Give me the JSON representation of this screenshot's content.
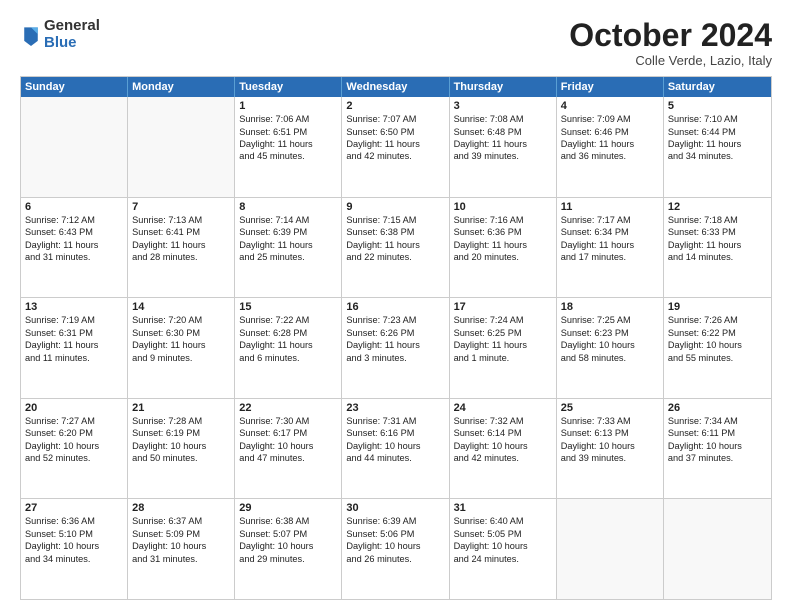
{
  "header": {
    "logo_general": "General",
    "logo_blue": "Blue",
    "month_title": "October 2024",
    "subtitle": "Colle Verde, Lazio, Italy"
  },
  "days_of_week": [
    "Sunday",
    "Monday",
    "Tuesday",
    "Wednesday",
    "Thursday",
    "Friday",
    "Saturday"
  ],
  "weeks": [
    [
      {
        "day": "",
        "empty": true
      },
      {
        "day": "",
        "empty": true
      },
      {
        "day": "1",
        "line1": "Sunrise: 7:06 AM",
        "line2": "Sunset: 6:51 PM",
        "line3": "Daylight: 11 hours",
        "line4": "and 45 minutes."
      },
      {
        "day": "2",
        "line1": "Sunrise: 7:07 AM",
        "line2": "Sunset: 6:50 PM",
        "line3": "Daylight: 11 hours",
        "line4": "and 42 minutes."
      },
      {
        "day": "3",
        "line1": "Sunrise: 7:08 AM",
        "line2": "Sunset: 6:48 PM",
        "line3": "Daylight: 11 hours",
        "line4": "and 39 minutes."
      },
      {
        "day": "4",
        "line1": "Sunrise: 7:09 AM",
        "line2": "Sunset: 6:46 PM",
        "line3": "Daylight: 11 hours",
        "line4": "and 36 minutes."
      },
      {
        "day": "5",
        "line1": "Sunrise: 7:10 AM",
        "line2": "Sunset: 6:44 PM",
        "line3": "Daylight: 11 hours",
        "line4": "and 34 minutes."
      }
    ],
    [
      {
        "day": "6",
        "line1": "Sunrise: 7:12 AM",
        "line2": "Sunset: 6:43 PM",
        "line3": "Daylight: 11 hours",
        "line4": "and 31 minutes."
      },
      {
        "day": "7",
        "line1": "Sunrise: 7:13 AM",
        "line2": "Sunset: 6:41 PM",
        "line3": "Daylight: 11 hours",
        "line4": "and 28 minutes."
      },
      {
        "day": "8",
        "line1": "Sunrise: 7:14 AM",
        "line2": "Sunset: 6:39 PM",
        "line3": "Daylight: 11 hours",
        "line4": "and 25 minutes."
      },
      {
        "day": "9",
        "line1": "Sunrise: 7:15 AM",
        "line2": "Sunset: 6:38 PM",
        "line3": "Daylight: 11 hours",
        "line4": "and 22 minutes."
      },
      {
        "day": "10",
        "line1": "Sunrise: 7:16 AM",
        "line2": "Sunset: 6:36 PM",
        "line3": "Daylight: 11 hours",
        "line4": "and 20 minutes."
      },
      {
        "day": "11",
        "line1": "Sunrise: 7:17 AM",
        "line2": "Sunset: 6:34 PM",
        "line3": "Daylight: 11 hours",
        "line4": "and 17 minutes."
      },
      {
        "day": "12",
        "line1": "Sunrise: 7:18 AM",
        "line2": "Sunset: 6:33 PM",
        "line3": "Daylight: 11 hours",
        "line4": "and 14 minutes."
      }
    ],
    [
      {
        "day": "13",
        "line1": "Sunrise: 7:19 AM",
        "line2": "Sunset: 6:31 PM",
        "line3": "Daylight: 11 hours",
        "line4": "and 11 minutes."
      },
      {
        "day": "14",
        "line1": "Sunrise: 7:20 AM",
        "line2": "Sunset: 6:30 PM",
        "line3": "Daylight: 11 hours",
        "line4": "and 9 minutes."
      },
      {
        "day": "15",
        "line1": "Sunrise: 7:22 AM",
        "line2": "Sunset: 6:28 PM",
        "line3": "Daylight: 11 hours",
        "line4": "and 6 minutes."
      },
      {
        "day": "16",
        "line1": "Sunrise: 7:23 AM",
        "line2": "Sunset: 6:26 PM",
        "line3": "Daylight: 11 hours",
        "line4": "and 3 minutes."
      },
      {
        "day": "17",
        "line1": "Sunrise: 7:24 AM",
        "line2": "Sunset: 6:25 PM",
        "line3": "Daylight: 11 hours",
        "line4": "and 1 minute."
      },
      {
        "day": "18",
        "line1": "Sunrise: 7:25 AM",
        "line2": "Sunset: 6:23 PM",
        "line3": "Daylight: 10 hours",
        "line4": "and 58 minutes."
      },
      {
        "day": "19",
        "line1": "Sunrise: 7:26 AM",
        "line2": "Sunset: 6:22 PM",
        "line3": "Daylight: 10 hours",
        "line4": "and 55 minutes."
      }
    ],
    [
      {
        "day": "20",
        "line1": "Sunrise: 7:27 AM",
        "line2": "Sunset: 6:20 PM",
        "line3": "Daylight: 10 hours",
        "line4": "and 52 minutes."
      },
      {
        "day": "21",
        "line1": "Sunrise: 7:28 AM",
        "line2": "Sunset: 6:19 PM",
        "line3": "Daylight: 10 hours",
        "line4": "and 50 minutes."
      },
      {
        "day": "22",
        "line1": "Sunrise: 7:30 AM",
        "line2": "Sunset: 6:17 PM",
        "line3": "Daylight: 10 hours",
        "line4": "and 47 minutes."
      },
      {
        "day": "23",
        "line1": "Sunrise: 7:31 AM",
        "line2": "Sunset: 6:16 PM",
        "line3": "Daylight: 10 hours",
        "line4": "and 44 minutes."
      },
      {
        "day": "24",
        "line1": "Sunrise: 7:32 AM",
        "line2": "Sunset: 6:14 PM",
        "line3": "Daylight: 10 hours",
        "line4": "and 42 minutes."
      },
      {
        "day": "25",
        "line1": "Sunrise: 7:33 AM",
        "line2": "Sunset: 6:13 PM",
        "line3": "Daylight: 10 hours",
        "line4": "and 39 minutes."
      },
      {
        "day": "26",
        "line1": "Sunrise: 7:34 AM",
        "line2": "Sunset: 6:11 PM",
        "line3": "Daylight: 10 hours",
        "line4": "and 37 minutes."
      }
    ],
    [
      {
        "day": "27",
        "line1": "Sunrise: 6:36 AM",
        "line2": "Sunset: 5:10 PM",
        "line3": "Daylight: 10 hours",
        "line4": "and 34 minutes."
      },
      {
        "day": "28",
        "line1": "Sunrise: 6:37 AM",
        "line2": "Sunset: 5:09 PM",
        "line3": "Daylight: 10 hours",
        "line4": "and 31 minutes."
      },
      {
        "day": "29",
        "line1": "Sunrise: 6:38 AM",
        "line2": "Sunset: 5:07 PM",
        "line3": "Daylight: 10 hours",
        "line4": "and 29 minutes."
      },
      {
        "day": "30",
        "line1": "Sunrise: 6:39 AM",
        "line2": "Sunset: 5:06 PM",
        "line3": "Daylight: 10 hours",
        "line4": "and 26 minutes."
      },
      {
        "day": "31",
        "line1": "Sunrise: 6:40 AM",
        "line2": "Sunset: 5:05 PM",
        "line3": "Daylight: 10 hours",
        "line4": "and 24 minutes."
      },
      {
        "day": "",
        "empty": true
      },
      {
        "day": "",
        "empty": true
      }
    ]
  ]
}
